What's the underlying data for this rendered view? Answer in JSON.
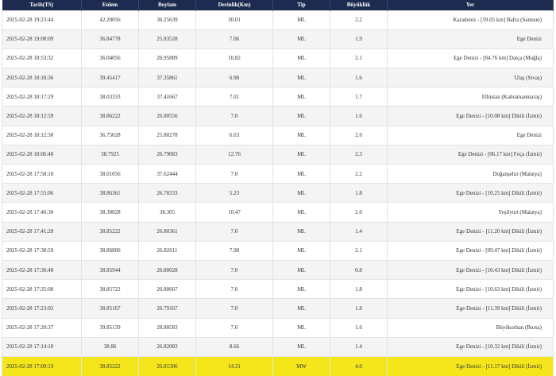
{
  "table": {
    "headers": [
      "Tarih(TS)",
      "Enlem",
      "Boylam",
      "Derinlik(Km)",
      "Tip",
      "Büyüklük",
      "Yer"
    ],
    "rows": [
      [
        "2025-02-28 19:23:44",
        "42.20056",
        "36.25639",
        "30.01",
        "ML",
        "2.2",
        "Karadeniz - [59.05 km] Bafra (Samsun)"
      ],
      [
        "2025-02-28 19:08:09",
        "36.84778",
        "25.83528",
        "7.06",
        "ML",
        "1.9",
        "Ege Denizi"
      ],
      [
        "2025-02-28 18:53:32",
        "36.04056",
        "26.95889",
        "10.82",
        "ML",
        "2.1",
        "Ege Denizi - [84.76 km] Datça (Muğla)"
      ],
      [
        "2025-02-28 18:18:36",
        "39.45417",
        "37.35861",
        "6.98",
        "ML",
        "1.6",
        "Ulaş (Sivas)"
      ],
      [
        "2025-02-28 18:17:29",
        "38.03333",
        "37.41667",
        "7.01",
        "ML",
        "1.7",
        "Elbistan (Kahramanmaraş)"
      ],
      [
        "2025-02-28 18:12:59",
        "38.86222",
        "26.80556",
        "7.0",
        "ML",
        "1.6",
        "Ege Denizi - [10.08 km] Dikili (İzmir)"
      ],
      [
        "2025-02-28 18:12:30",
        "36.75028",
        "25.80278",
        "6.63",
        "ML",
        "2.6",
        "Ege Denizi"
      ],
      [
        "2025-02-28 18:06:40",
        "38.7925",
        "26.79083",
        "12.76",
        "ML",
        "2.3",
        "Ege Denizi - [06.17 km] Foça (İzmir)"
      ],
      [
        "2025-02-28 17:58:10",
        "38.01056",
        "37.62444",
        "7.0",
        "ML",
        "2.2",
        "Doğanşehir (Malatya)"
      ],
      [
        "2025-02-28 17:55:06",
        "38.86361",
        "26.78333",
        "5.23",
        "ML",
        "1.8",
        "Ege Denizi - [10.25 km] Dikili (İzmir)"
      ],
      [
        "2025-02-28 17:46:30",
        "38.30028",
        "38.305",
        "10.47",
        "ML",
        "2.0",
        "Yeşilyurt (Malatya)"
      ],
      [
        "2025-02-28 17:41:28",
        "38.85222",
        "26.80361",
        "7.0",
        "ML",
        "1.4",
        "Ege Denizi - [11.20 km] Dikili (İzmir)"
      ],
      [
        "2025-02-28 17:38:59",
        "38.86806",
        "26.82611",
        "7.98",
        "ML",
        "2.1",
        "Ege Denizi - [09.47 km] Dikili (İzmir)"
      ],
      [
        "2025-02-28 17:36:48",
        "38.85944",
        "26.80028",
        "7.0",
        "ML",
        "0.8",
        "Ege Denizi - [10.43 km] Dikili (İzmir)"
      ],
      [
        "2025-02-28 17:35:08",
        "38.85722",
        "26.80667",
        "7.0",
        "ML",
        "1.8",
        "Ege Denizi - [10.63 km] Dikili (İzmir)"
      ],
      [
        "2025-02-28 17:23:02",
        "38.85167",
        "26.79167",
        "7.0",
        "ML",
        "1.8",
        "Ege Denizi - [11.39 km] Dikili (İzmir)"
      ],
      [
        "2025-02-28 17:20:37",
        "39.85139",
        "28.88583",
        "7.0",
        "ML",
        "1.6",
        "Büyükorhan (Bursa)"
      ],
      [
        "2025-02-28 17:14:18",
        "38.86",
        "26.82083",
        "8.66",
        "ML",
        "1.4",
        "Ege Denizi - [10.32 km] Dikili (İzmir)"
      ],
      [
        "2025-02-28 17:09:19",
        "38.85222",
        "26.81306",
        "14.31",
        "MW",
        "4.0",
        "Ege Denizi - [11.17 km] Dikili (İzmir)"
      ]
    ],
    "highlight_row": 18,
    "colors": {
      "header_bg": "#1c2b4f",
      "header_text": "#ffffff",
      "highlight_bg": "#f4e61b",
      "alt_row_bg": "#f4f4f4"
    }
  }
}
